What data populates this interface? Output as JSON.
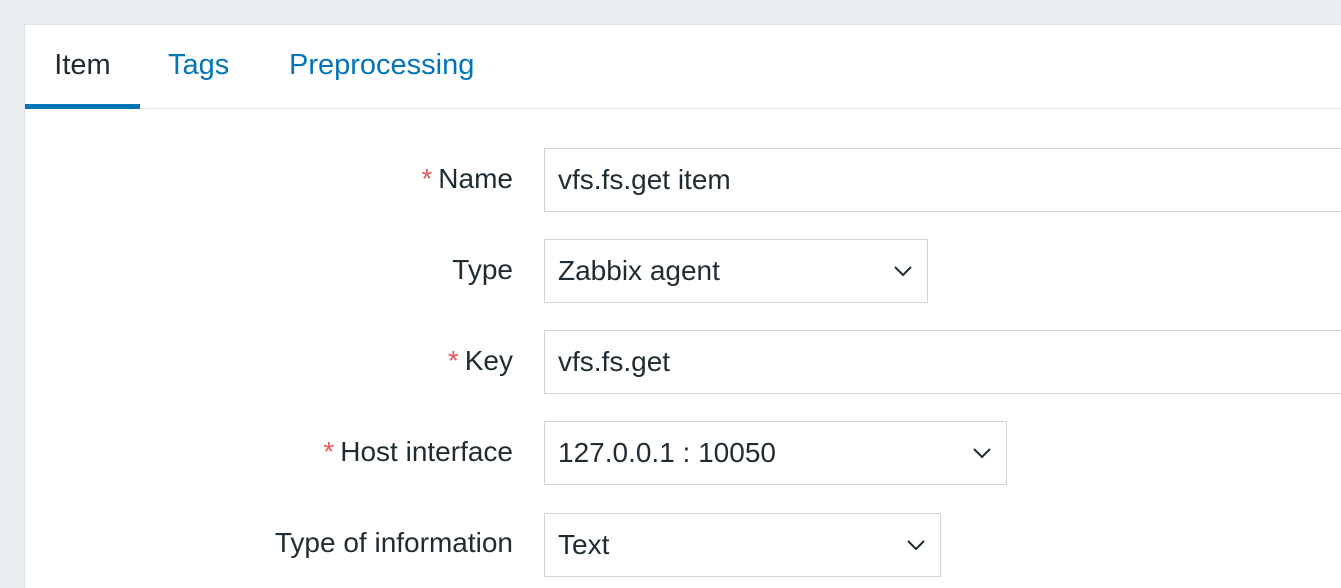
{
  "tabs": [
    {
      "label": "Item",
      "active": true
    },
    {
      "label": "Tags",
      "active": false
    },
    {
      "label": "Preprocessing",
      "active": false
    }
  ],
  "form": {
    "required_marker": "*",
    "name": {
      "label": "Name",
      "value": "vfs.fs.get item"
    },
    "type": {
      "label": "Type",
      "value": "Zabbix agent"
    },
    "key": {
      "label": "Key",
      "value": "vfs.fs.get"
    },
    "host_interface": {
      "label": "Host interface",
      "value": "127.0.0.1 : 10050"
    },
    "type_of_information": {
      "label": "Type of information",
      "value": "Text"
    }
  },
  "colors": {
    "link": "#0275b8",
    "required": "#e45959",
    "text": "#1f2c33",
    "background": "#ebeef0"
  },
  "icons": {
    "dropdown": "chevron-down-icon"
  }
}
